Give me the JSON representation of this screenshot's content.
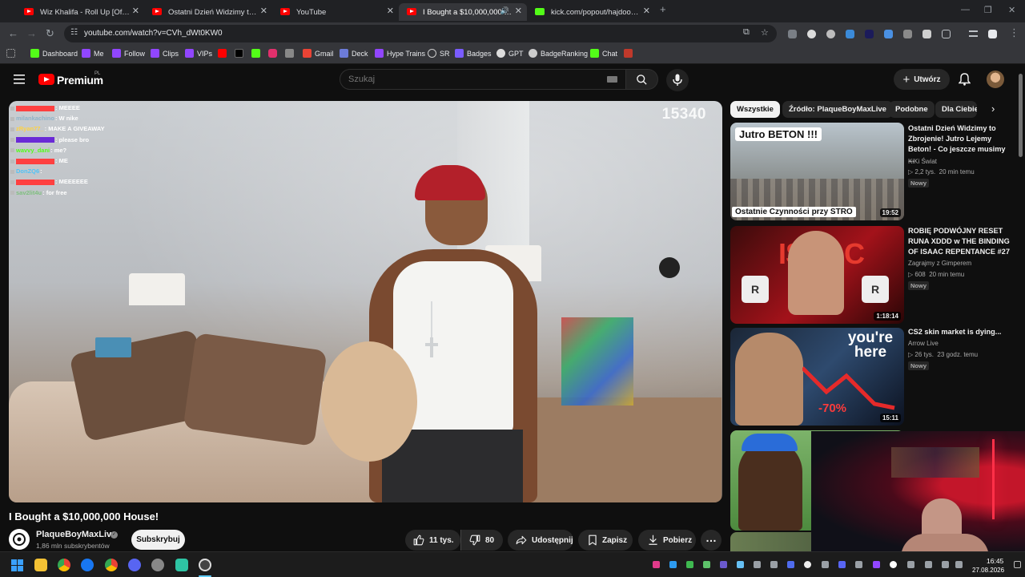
{
  "browser": {
    "tabs": [
      {
        "title": "Wiz Khalifa - Roll Up [Official M",
        "favicon": "youtube-icon"
      },
      {
        "title": "Ostatni Dzień Widzimy to Zbroj",
        "favicon": "youtube-icon"
      },
      {
        "title": "YouTube",
        "favicon": "youtube-icon"
      },
      {
        "title": "I Bought a $10,000,000 Hou",
        "favicon": "youtube-icon",
        "active": true,
        "audio": true
      },
      {
        "title": "kick.com/popout/hajdook/chat",
        "favicon": "kick-icon"
      }
    ],
    "url": "youtube.com/watch?v=CVh_dWt0KW0",
    "bookmarks": [
      "Dashboard",
      "Me",
      "Follow",
      "Clips",
      "VIPs",
      "Gmail",
      "Deck",
      "Hype Trains",
      "SR",
      "Badges",
      "GPT",
      "BadgeRanking",
      "Chat"
    ]
  },
  "youtube": {
    "logo": "Premium",
    "country": "PL",
    "search_placeholder": "Szukaj",
    "create_label": "Utwórz",
    "video": {
      "title": "I Bought a $10,000,000 House!",
      "viewer_overlay": "15340",
      "channel": "PlaqueBoyMaxLive",
      "subscribers": "1,86 mln subskrybentów",
      "subscribe_label": "Subskrybuj",
      "likes": "11 tys.",
      "dislikes": "80",
      "share_label": "Udostępnij",
      "save_label": "Zapisz",
      "download_label": "Pobierz"
    },
    "chat_overlay": [
      {
        "user": "",
        "message": "MEEEE",
        "color": "#ff4040"
      },
      {
        "user": "milankachino",
        "message": "W nike",
        "color": "#8fb3c9"
      },
      {
        "user": "zRyan77_",
        "message": "MAKE A GIVEAWAY",
        "color": "#ffd23f"
      },
      {
        "user": "",
        "message": "please bro",
        "color": "#6a2ad6"
      },
      {
        "user": "wavvy_dani",
        "message": "me?",
        "color": "#53fc18"
      },
      {
        "user": "",
        "message": "ME",
        "color": "#ff4040"
      },
      {
        "user": "DonZQ6",
        "message": "",
        "color": "#4fc3f7"
      },
      {
        "user": "",
        "message": "MEEEEEE",
        "color": "#ff4040"
      },
      {
        "user": "sav2lit4u",
        "message": "for free",
        "color": "#7fbf7f"
      }
    ],
    "chips": [
      "Wszystkie",
      "Źródło: PlaqueBoyMaxLive",
      "Podobne",
      "Dla Ciebie"
    ],
    "recommendations": [
      {
        "title": "Ostatni Dzień Widzimy to Zbrojenie! Jutro Lejemy Beton! - Co jeszcze musimy ...",
        "channel": "KiKi Świat",
        "views": "2,2 tys.",
        "age": "20 min temu",
        "badge": "Nowy",
        "duration": "19:52",
        "thumb_top": "Jutro BETON !!!",
        "thumb_bottom": "Ostatnie Czynności przy STRO"
      },
      {
        "title": "ROBIĘ PODWÓJNY RESET RUNA XDDD w THE BINDING OF ISAAC REPENTANCE #27",
        "channel": "Zagrajmy z Gimperem",
        "views": "608",
        "age": "20 min temu",
        "badge": "Nowy",
        "duration": "1:18:14",
        "thumb_top": "ISAAC"
      },
      {
        "title": "CS2 skin market is dying...",
        "channel": "Arrow Live",
        "views": "26 tys.",
        "age": "23 godz. temu",
        "badge": "Nowy",
        "duration": "15:11",
        "thumb_top": "you're here",
        "thumb_bottom": "-70%"
      }
    ]
  },
  "taskbar": {
    "time": "16:45",
    "date": "27.08.2026"
  }
}
